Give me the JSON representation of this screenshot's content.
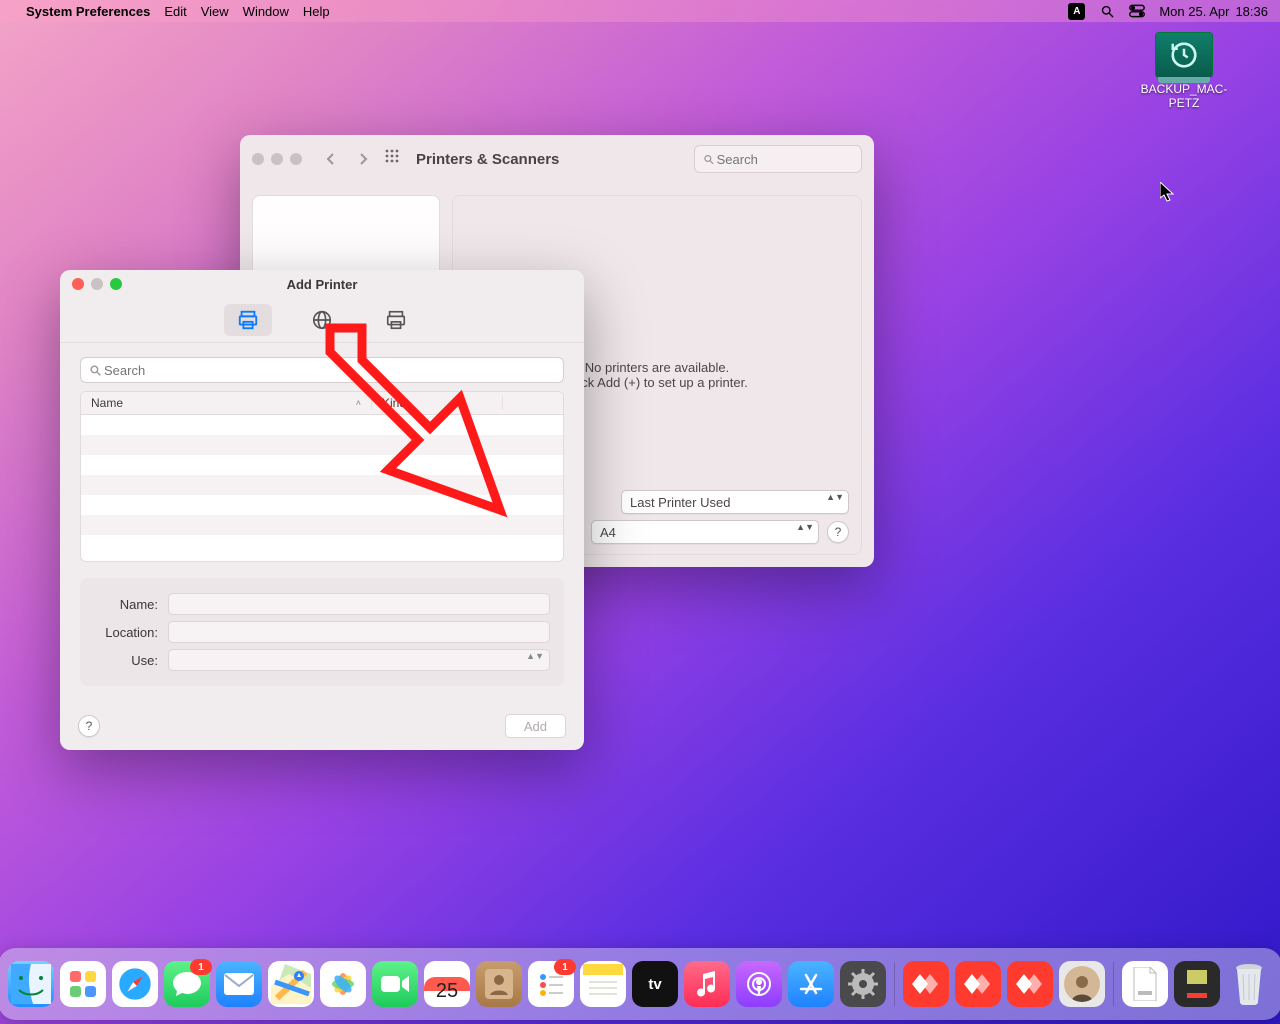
{
  "menubar": {
    "app": "System Preferences",
    "items": [
      "Edit",
      "View",
      "Window",
      "Help"
    ],
    "keyboard_indicator": "A",
    "date": "Mon 25. Apr",
    "time": "18:36"
  },
  "desktop_drive": {
    "label": "BACKUP_MAC-PETZ"
  },
  "pref_window": {
    "title": "Printers & Scanners",
    "search_placeholder": "Search",
    "msg1": "No printers are available.",
    "msg2": "Click Add (+) to set up a printer.",
    "default_printer": "Last Printer Used",
    "paper_size": "A4"
  },
  "add_printer": {
    "title": "Add Printer",
    "search_placeholder": "Search",
    "col_name": "Name",
    "col_kind": "Kind",
    "field_name": "Name:",
    "field_location": "Location:",
    "field_use": "Use:",
    "add_button": "Add"
  },
  "dock": {
    "cal_month": "APR",
    "cal_day": "25",
    "badges": {
      "messages": "1",
      "reminders": "1"
    }
  }
}
